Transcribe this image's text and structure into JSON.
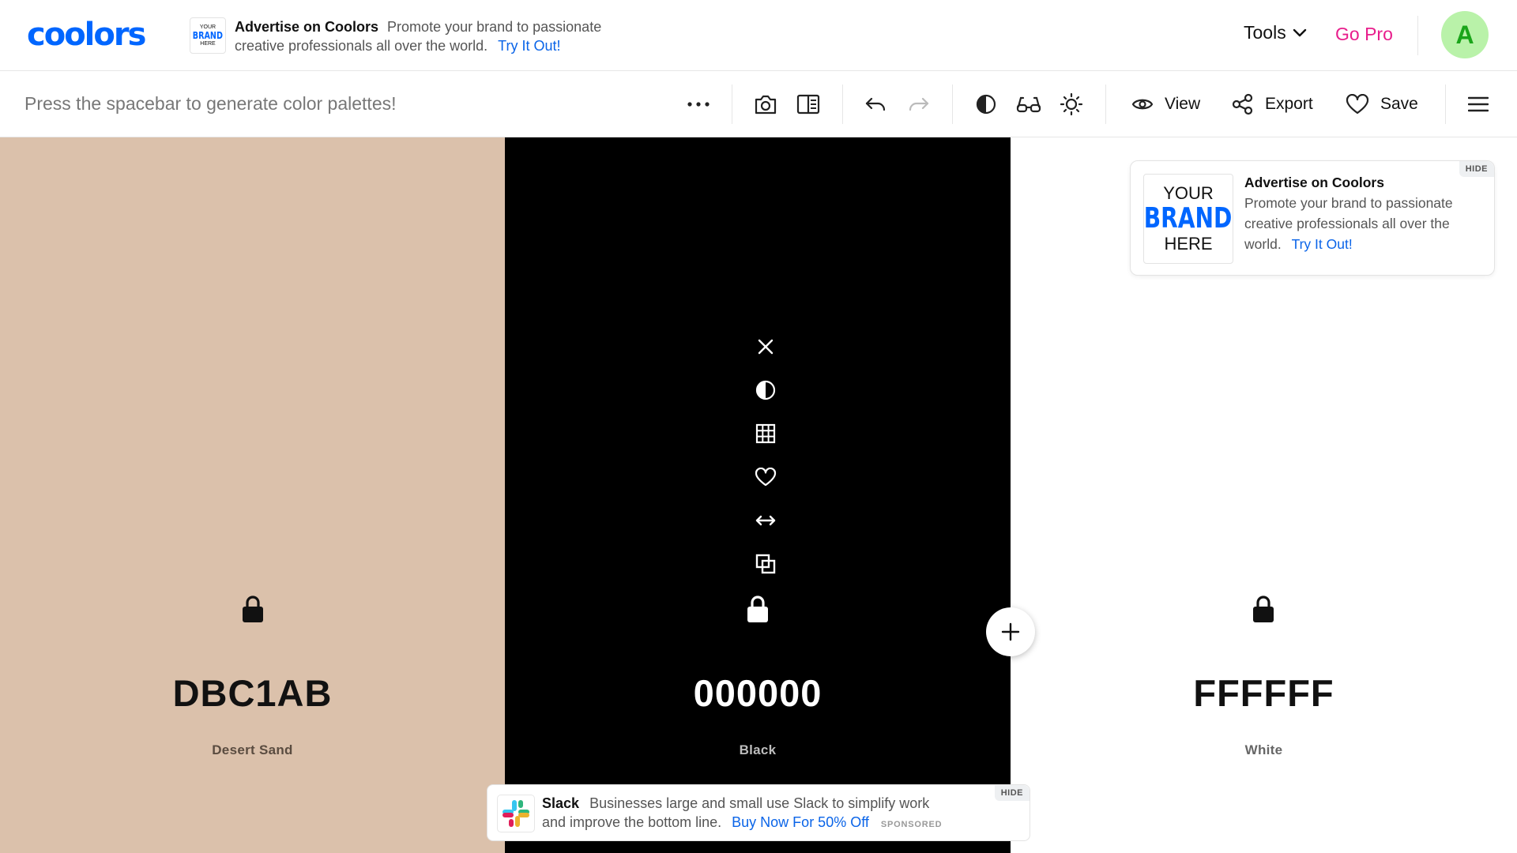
{
  "nav": {
    "logo": "coolors",
    "ad": {
      "brand_lines": [
        "YOUR",
        "BRAND",
        "HERE"
      ],
      "title": "Advertise on Coolors",
      "body": "Promote your brand to passionate creative professionals all over the world.",
      "link": "Try It Out!"
    },
    "tools_label": "Tools",
    "gopro_label": "Go Pro",
    "avatar_initial": "A"
  },
  "toolbar": {
    "hint": "Press the spacebar to generate color palettes!",
    "view_label": "View",
    "export_label": "Export",
    "save_label": "Save",
    "icons": [
      "more-icon",
      "camera-icon",
      "sidebar-icon",
      "undo-icon",
      "redo-icon",
      "contrast-icon",
      "glasses-icon",
      "brightness-icon",
      "eye-icon",
      "share-icon",
      "heart-icon",
      "menu-icon"
    ]
  },
  "palette": {
    "colors": [
      {
        "hex": "DBC1AB",
        "name": "Desert Sand",
        "bg": "#DBC1AB",
        "fg": "#111111",
        "name_color": "#5a4c40"
      },
      {
        "hex": "000000",
        "name": "Black",
        "bg": "#000000",
        "fg": "#ffffff",
        "name_color": "#bdbdbd"
      },
      {
        "hex": "FFFFFF",
        "name": "White",
        "bg": "#FFFFFF",
        "fg": "#111111",
        "name_color": "#666666"
      }
    ],
    "column_tools": [
      "close-icon",
      "contrast-icon",
      "shades-icon",
      "heart-icon",
      "drag-icon",
      "copy-icon",
      "lock-icon"
    ]
  },
  "side_ad": {
    "brand_lines": [
      "YOUR",
      "BRAND",
      "HERE"
    ],
    "title": "Advertise on Coolors",
    "body": "Promote your brand to passionate creative professionals all over the world.",
    "link": "Try It Out!",
    "hide": "HIDE"
  },
  "bottom_ad": {
    "title": "Slack",
    "body": "Businesses large and small use Slack to simplify work and improve the bottom line.",
    "link": "Buy Now For 50% Off",
    "sponsored": "SPONSORED",
    "hide": "HIDE"
  },
  "colors": {
    "accent": "#0066ff",
    "gopro": "#e81e8c",
    "avatar_bg": "#b9f2a9",
    "avatar_fg": "#1aa51a",
    "link": "#0a64e8"
  }
}
